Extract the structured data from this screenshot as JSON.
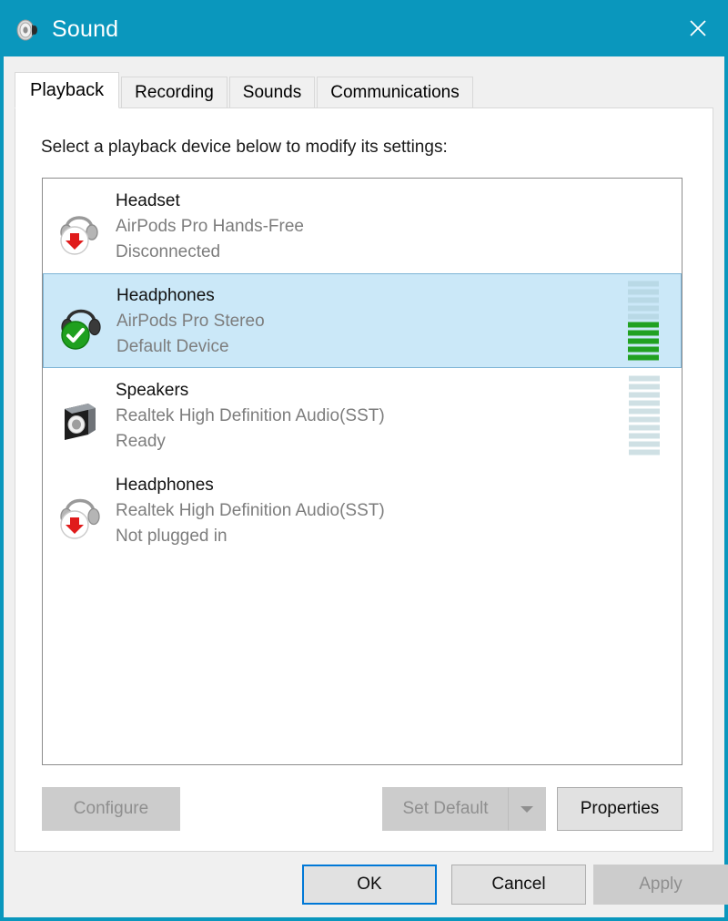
{
  "window": {
    "title": "Sound",
    "icon": "speaker-icon",
    "close_label": "✕",
    "accent_color": "#0a97bd"
  },
  "tabs": [
    {
      "label": "Playback",
      "active": true
    },
    {
      "label": "Recording",
      "active": false
    },
    {
      "label": "Sounds",
      "active": false
    },
    {
      "label": "Communications",
      "active": false
    }
  ],
  "main": {
    "instruction": "Select a playback device below to modify its settings:"
  },
  "devices": [
    {
      "name": "Headset",
      "description": "AirPods Pro Hands-Free",
      "status": "Disconnected",
      "icon": "headset-icon",
      "badge": "red-down-arrow-badge",
      "selected": false,
      "meter_visible": false,
      "meter_segments": 0,
      "meter_active": 0
    },
    {
      "name": "Headphones",
      "description": "AirPods Pro Stereo",
      "status": "Default Device",
      "icon": "headphones-icon",
      "badge": "green-check-badge",
      "selected": true,
      "meter_visible": true,
      "meter_segments": 10,
      "meter_active": 5
    },
    {
      "name": "Speakers",
      "description": "Realtek High Definition Audio(SST)",
      "status": "Ready",
      "icon": "speaker-box-icon",
      "badge": "",
      "selected": false,
      "meter_visible": true,
      "meter_segments": 10,
      "meter_active": 0
    },
    {
      "name": "Headphones",
      "description": "Realtek High Definition Audio(SST)",
      "status": "Not plugged in",
      "icon": "headphones-icon",
      "badge": "red-down-arrow-badge",
      "selected": false,
      "meter_visible": false,
      "meter_segments": 0,
      "meter_active": 0
    }
  ],
  "actions": {
    "configure": {
      "label": "Configure",
      "disabled": true
    },
    "set_default": {
      "label": "Set Default",
      "disabled": true,
      "has_dropdown": true
    },
    "properties": {
      "label": "Properties",
      "disabled": false
    }
  },
  "footer": {
    "ok": {
      "label": "OK",
      "default": true
    },
    "cancel": {
      "label": "Cancel",
      "default": false
    },
    "apply": {
      "label": "Apply",
      "disabled": true
    }
  },
  "colors": {
    "titlebar": "#0a97bd",
    "selection": "#cbe8f8",
    "meter_active": "#21a121",
    "meter_inactive": "#b9d9e6",
    "focus_border": "#0078d7"
  }
}
